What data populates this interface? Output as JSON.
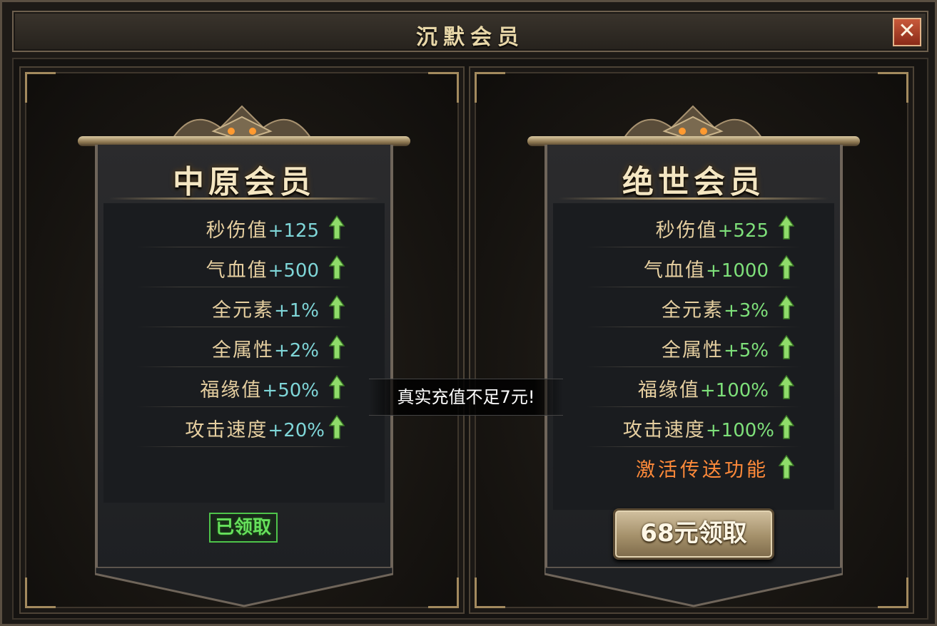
{
  "window": {
    "title": "沉默会员",
    "close_icon": "close-icon",
    "close_label": "✕"
  },
  "colors": {
    "stat_name": "#e6cfa0",
    "value_left": "#7fd6d8",
    "value_right": "#7ee07a",
    "special_feature": "#ff8a3a",
    "claimed_badge": "#66e05c"
  },
  "left_card": {
    "title": "中原会员",
    "stats": [
      {
        "name": "秒伤值",
        "value": "+125"
      },
      {
        "name": "气血值",
        "value": "+500"
      },
      {
        "name": "全元素",
        "value": "+1%"
      },
      {
        "name": "全属性",
        "value": "+2%"
      },
      {
        "name": "福缘值",
        "value": "+50%"
      },
      {
        "name": "攻击速度",
        "value": "+20%"
      }
    ],
    "status_label": "已领取"
  },
  "right_card": {
    "title": "绝世会员",
    "stats": [
      {
        "name": "秒伤值",
        "value": "+525"
      },
      {
        "name": "气血值",
        "value": "+1000"
      },
      {
        "name": "全元素",
        "value": "+3%"
      },
      {
        "name": "全属性",
        "value": "+5%"
      },
      {
        "name": "福缘值",
        "value": "+100%"
      },
      {
        "name": "攻击速度",
        "value": "+100%"
      }
    ],
    "special_feature": "激活传送功能",
    "buy_label": "68元领取"
  },
  "toast": {
    "message": "真实充值不足7元!"
  }
}
